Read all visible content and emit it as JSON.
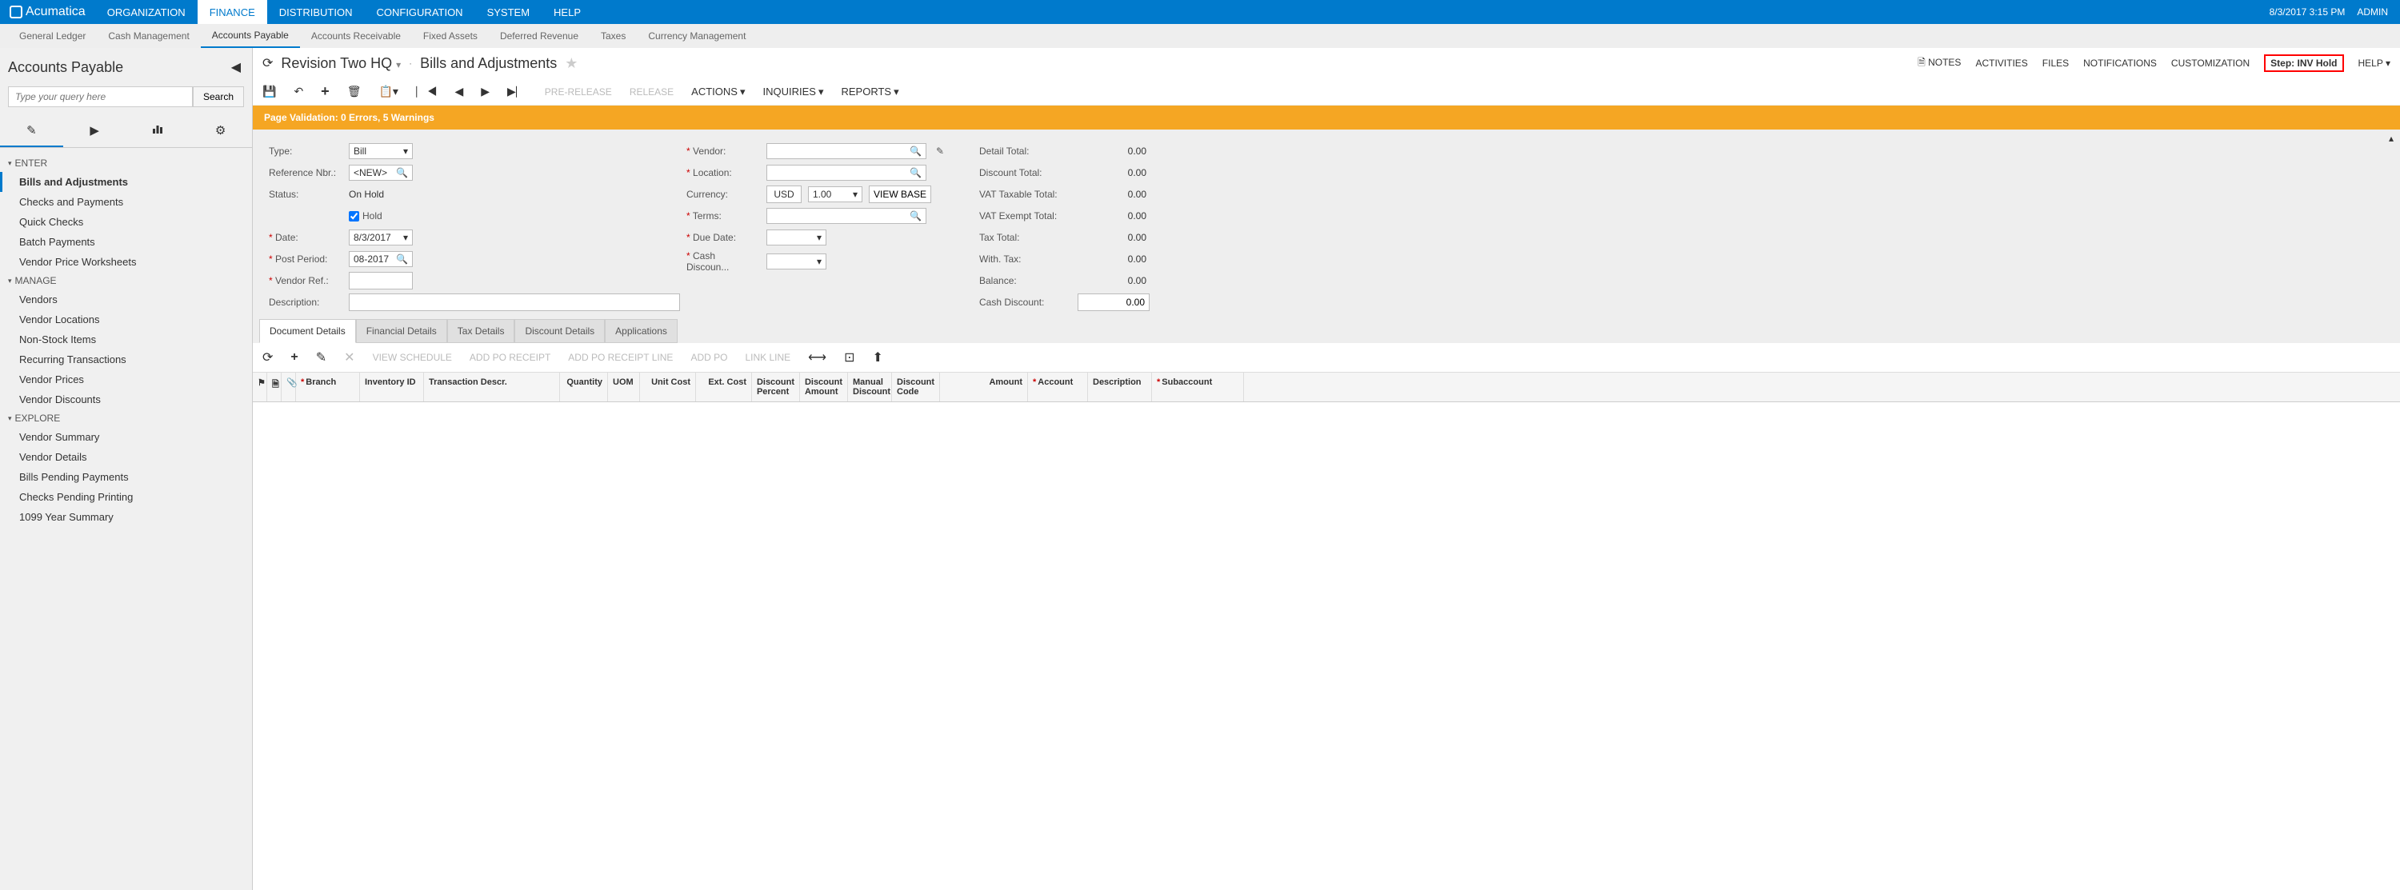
{
  "brand": "Acumatica",
  "topModules": [
    "ORGANIZATION",
    "FINANCE",
    "DISTRIBUTION",
    "CONFIGURATION",
    "SYSTEM",
    "HELP"
  ],
  "activeModule": "FINANCE",
  "datetime": "8/3/2017  3:15 PM",
  "user": "ADMIN",
  "subModules": [
    "General Ledger",
    "Cash Management",
    "Accounts Payable",
    "Accounts Receivable",
    "Fixed Assets",
    "Deferred Revenue",
    "Taxes",
    "Currency Management"
  ],
  "activeSub": "Accounts Payable",
  "sidebar": {
    "title": "Accounts Payable",
    "searchPlaceholder": "Type your query here",
    "searchBtn": "Search",
    "groups": [
      {
        "label": "ENTER",
        "items": [
          "Bills and Adjustments",
          "Checks and Payments",
          "Quick Checks",
          "Batch Payments",
          "Vendor Price Worksheets"
        ]
      },
      {
        "label": "MANAGE",
        "items": [
          "Vendors",
          "Vendor Locations",
          "Non-Stock Items",
          "Recurring Transactions",
          "Vendor Prices",
          "Vendor Discounts"
        ]
      },
      {
        "label": "EXPLORE",
        "items": [
          "Vendor Summary",
          "Vendor Details",
          "Bills Pending Payments",
          "Checks Pending Printing",
          "1099 Year Summary"
        ]
      }
    ],
    "activeItem": "Bills and Adjustments"
  },
  "header": {
    "company": "Revision Two HQ",
    "screen": "Bills and Adjustments",
    "actions": [
      "NOTES",
      "ACTIVITIES",
      "FILES",
      "NOTIFICATIONS",
      "CUSTOMIZATION"
    ],
    "step": "Step: INV Hold",
    "help": "HELP"
  },
  "toolbar": {
    "preRelease": "PRE-RELEASE",
    "release": "RELEASE",
    "menus": [
      "ACTIONS",
      "INQUIRIES",
      "REPORTS"
    ]
  },
  "validation": "Page Validation: 0 Errors, 5 Warnings",
  "form": {
    "labels": {
      "type": "Type:",
      "refNbr": "Reference Nbr.:",
      "status": "Status:",
      "hold": "Hold",
      "date": "Date:",
      "postPeriod": "Post Period:",
      "vendorRef": "Vendor Ref.:",
      "description": "Description:",
      "vendor": "Vendor:",
      "location": "Location:",
      "currency": "Currency:",
      "terms": "Terms:",
      "dueDate": "Due Date:",
      "cashDiscount": "Cash Discoun...",
      "detailTotal": "Detail Total:",
      "discountTotal": "Discount Total:",
      "vatTaxable": "VAT Taxable Total:",
      "vatExempt": "VAT Exempt Total:",
      "taxTotal": "Tax Total:",
      "withTax": "With. Tax:",
      "balance": "Balance:",
      "cashDiscountTotal": "Cash Discount:"
    },
    "values": {
      "type": "Bill",
      "refNbr": "<NEW>",
      "status": "On Hold",
      "hold": true,
      "date": "8/3/2017",
      "postPeriod": "08-2017",
      "vendorRef": "",
      "description": "",
      "vendor": "",
      "location": "",
      "currencyCode": "USD",
      "currencyRate": "1.00",
      "viewBase": "VIEW BASE",
      "terms": "",
      "dueDate": "",
      "cashDiscountDate": "",
      "detailTotal": "0.00",
      "discountTotal": "0.00",
      "vatTaxable": "0.00",
      "vatExempt": "0.00",
      "taxTotal": "0.00",
      "withTax": "0.00",
      "balance": "0.00",
      "cashDiscountTotal": "0.00"
    }
  },
  "detailTabs": [
    "Document Details",
    "Financial Details",
    "Tax Details",
    "Discount Details",
    "Applications"
  ],
  "activeDetailTab": "Document Details",
  "gridToolbar": {
    "textBtns": [
      "VIEW SCHEDULE",
      "ADD PO RECEIPT",
      "ADD PO RECEIPT LINE",
      "ADD PO",
      "LINK LINE"
    ]
  },
  "gridColumns": [
    {
      "w": 18,
      "label": "",
      "req": false,
      "icon": "status"
    },
    {
      "w": 18,
      "label": "",
      "req": false,
      "icon": "note"
    },
    {
      "w": 18,
      "label": "",
      "req": false,
      "icon": "attach"
    },
    {
      "w": 80,
      "label": "Branch",
      "req": true
    },
    {
      "w": 80,
      "label": "Inventory ID",
      "req": false
    },
    {
      "w": 170,
      "label": "Transaction Descr.",
      "req": false
    },
    {
      "w": 60,
      "label": "Quantity",
      "req": false,
      "align": "right"
    },
    {
      "w": 40,
      "label": "UOM",
      "req": false
    },
    {
      "w": 70,
      "label": "Unit Cost",
      "req": false,
      "align": "right"
    },
    {
      "w": 70,
      "label": "Ext. Cost",
      "req": false,
      "align": "right"
    },
    {
      "w": 60,
      "label": "Discount Percent",
      "req": false,
      "align": "right"
    },
    {
      "w": 60,
      "label": "Discount Amount",
      "req": false,
      "align": "right"
    },
    {
      "w": 55,
      "label": "Manual Discount",
      "req": false
    },
    {
      "w": 60,
      "label": "Discount Code",
      "req": false
    },
    {
      "w": 110,
      "label": "Amount",
      "req": false,
      "align": "right"
    },
    {
      "w": 75,
      "label": "Account",
      "req": true
    },
    {
      "w": 80,
      "label": "Description",
      "req": false
    },
    {
      "w": 115,
      "label": "Subaccount",
      "req": true
    }
  ]
}
